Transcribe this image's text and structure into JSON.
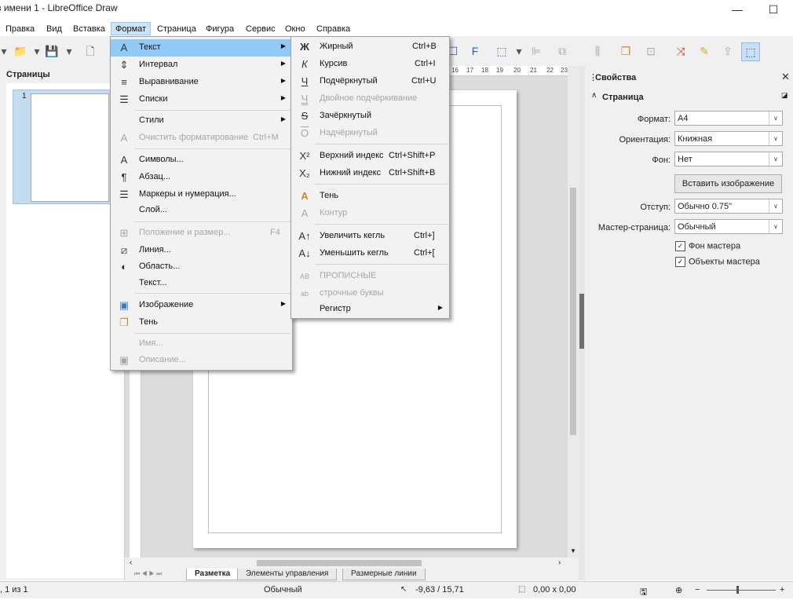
{
  "window": {
    "title": "з имени 1 - LibreOffice Draw",
    "minimize": "—",
    "maximize": "☐",
    "close": "✕"
  },
  "menubar": {
    "items": [
      "Правка",
      "Вид",
      "Вставка",
      "Формат",
      "Страница",
      "Фигура",
      "Сервис",
      "Окно",
      "Справка"
    ],
    "active": "Формат"
  },
  "pages_pane": {
    "title": "Страницы",
    "page_number": "1"
  },
  "ruler": {
    "ticks": [
      "16",
      "17",
      "18",
      "19",
      "20",
      "21",
      "22",
      "23"
    ]
  },
  "format_menu": [
    {
      "icon": "text-icon",
      "glyph": "A",
      "label": "Текст",
      "shortcut": "",
      "submenu": true,
      "disabled": false,
      "highlighted": true
    },
    {
      "icon": "spacing-icon",
      "glyph": "⇕",
      "label": "Интервал",
      "shortcut": "",
      "submenu": true,
      "disabled": false
    },
    {
      "icon": "align-icon",
      "glyph": "≡",
      "label": "Выравнивание",
      "shortcut": "",
      "submenu": true,
      "disabled": false
    },
    {
      "icon": "list-icon",
      "glyph": "☰",
      "label": "Списки",
      "shortcut": "",
      "submenu": true,
      "disabled": false
    },
    {
      "separator": true
    },
    {
      "icon": "",
      "glyph": "",
      "label": "Стили",
      "shortcut": "",
      "submenu": true,
      "disabled": false
    },
    {
      "icon": "clear-format-icon",
      "glyph": "A",
      "label": "Очистить форматирование",
      "shortcut": "Ctrl+M",
      "submenu": false,
      "disabled": true
    },
    {
      "separator": true
    },
    {
      "icon": "character-icon",
      "glyph": "A",
      "label": "Символы...",
      "shortcut": "",
      "submenu": false,
      "disabled": false
    },
    {
      "icon": "paragraph-icon",
      "glyph": "¶",
      "label": "Абзац...",
      "shortcut": "",
      "submenu": false,
      "disabled": false
    },
    {
      "icon": "bullets-icon",
      "glyph": "☰",
      "label": "Маркеры и нумерация...",
      "shortcut": "",
      "submenu": false,
      "disabled": false
    },
    {
      "icon": "",
      "glyph": "",
      "label": "Слой...",
      "shortcut": "",
      "submenu": false,
      "disabled": false
    },
    {
      "separator": true
    },
    {
      "icon": "position-size-icon",
      "glyph": "⊞",
      "label": "Положение и размер...",
      "shortcut": "F4",
      "submenu": false,
      "disabled": true
    },
    {
      "icon": "line-icon",
      "glyph": "⧄",
      "label": "Линия...",
      "shortcut": "",
      "submenu": false,
      "disabled": false
    },
    {
      "icon": "area-icon",
      "glyph": "◐",
      "label": "Область...",
      "shortcut": "",
      "submenu": false,
      "disabled": false
    },
    {
      "icon": "",
      "glyph": "",
      "label": "Текст...",
      "shortcut": "",
      "submenu": false,
      "disabled": false
    },
    {
      "separator": true
    },
    {
      "icon": "image-icon",
      "glyph": "▣",
      "label": "Изображение",
      "shortcut": "",
      "submenu": true,
      "disabled": false
    },
    {
      "icon": "shadow-icon",
      "glyph": "❐",
      "label": "Тень",
      "shortcut": "",
      "submenu": false,
      "disabled": false
    },
    {
      "separator": true
    },
    {
      "icon": "",
      "glyph": "",
      "label": "Имя...",
      "shortcut": "",
      "submenu": false,
      "disabled": true
    },
    {
      "icon": "description-icon",
      "glyph": "▣",
      "label": "Описание...",
      "shortcut": "",
      "submenu": false,
      "disabled": true
    }
  ],
  "text_submenu": [
    {
      "icon": "bold-icon",
      "glyph": "Ж",
      "label": "Жирный",
      "shortcut": "Ctrl+B",
      "submenu": false,
      "disabled": false
    },
    {
      "icon": "italic-icon",
      "glyph": "К",
      "label": "Курсив",
      "shortcut": "Ctrl+I",
      "submenu": false,
      "disabled": false
    },
    {
      "icon": "underline-icon",
      "glyph": "Ч",
      "label": "Подчёркнутый",
      "shortcut": "Ctrl+U",
      "submenu": false,
      "disabled": false
    },
    {
      "icon": "double-underline-icon",
      "glyph": "Ч",
      "label": "Двойное подчёркивание",
      "shortcut": "",
      "submenu": false,
      "disabled": true
    },
    {
      "icon": "strikethrough-icon",
      "glyph": "S",
      "label": "Зачёркнутый",
      "shortcut": "",
      "submenu": false,
      "disabled": false
    },
    {
      "icon": "overline-icon",
      "glyph": "O",
      "label": "Надчёркнутый",
      "shortcut": "",
      "submenu": false,
      "disabled": true
    },
    {
      "separator": true
    },
    {
      "icon": "superscript-icon",
      "glyph": "X²",
      "label": "Верхний индекс",
      "shortcut": "Ctrl+Shift+P",
      "submenu": false,
      "disabled": false
    },
    {
      "icon": "subscript-icon",
      "glyph": "X₂",
      "label": "Нижний индекс",
      "shortcut": "Ctrl+Shift+B",
      "submenu": false,
      "disabled": false
    },
    {
      "separator": true
    },
    {
      "icon": "shadow-text-icon",
      "glyph": "A",
      "label": "Тень",
      "shortcut": "",
      "submenu": false,
      "disabled": false
    },
    {
      "icon": "outline-text-icon",
      "glyph": "A",
      "label": "Контур",
      "shortcut": "",
      "submenu": false,
      "disabled": true
    },
    {
      "separator": true
    },
    {
      "icon": "grow-font-icon",
      "glyph": "A↑",
      "label": "Увеличить кегль",
      "shortcut": "Ctrl+]",
      "submenu": false,
      "disabled": false
    },
    {
      "icon": "shrink-font-icon",
      "glyph": "A↓",
      "label": "Уменьшить кегль",
      "shortcut": "Ctrl+[",
      "submenu": false,
      "disabled": false
    },
    {
      "separator": true
    },
    {
      "icon": "uppercase-icon",
      "glyph": "AB",
      "label": "ПРОПИСНЫЕ",
      "shortcut": "",
      "submenu": false,
      "disabled": true
    },
    {
      "icon": "lowercase-icon",
      "glyph": "ab",
      "label": "строчные буквы",
      "shortcut": "",
      "submenu": false,
      "disabled": true
    },
    {
      "icon": "",
      "glyph": "",
      "label": "Регистр",
      "shortcut": "",
      "submenu": true,
      "disabled": false
    }
  ],
  "sidebar": {
    "title": "Свойства",
    "close": "✕",
    "section": "Страница",
    "fields": [
      {
        "label": "Формат:",
        "value": "A4"
      },
      {
        "label": "Ориентация:",
        "value": "Книжная"
      },
      {
        "label": "Фон:",
        "value": "Нет"
      }
    ],
    "insert_image_button": "Вставить изображение",
    "fields2": [
      {
        "label": "Отступ:",
        "value": "Обычно 0.75\""
      },
      {
        "label": "Мастер-страница:",
        "value": "Обычный"
      }
    ],
    "checkboxes": [
      {
        "label": "Фон мастера",
        "checked": true
      },
      {
        "label": "Объекты мастера",
        "checked": true
      }
    ]
  },
  "tabs": {
    "items": [
      "Разметка",
      "Элементы управления",
      "Размерные линии"
    ],
    "active": "Разметка"
  },
  "status": {
    "page": ", 1 из 1",
    "style": "Обычный",
    "position": "-9,63 / 15,71",
    "size": "0,00 x 0,00",
    "zoom_minus": "−",
    "zoom_plus": "+"
  }
}
